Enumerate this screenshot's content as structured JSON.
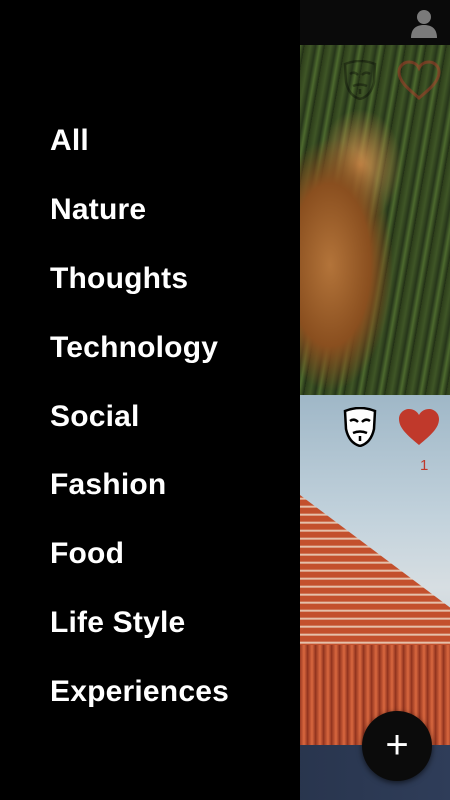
{
  "drawer": {
    "categories": [
      {
        "label": "All"
      },
      {
        "label": "Nature"
      },
      {
        "label": "Thoughts"
      },
      {
        "label": "Technology"
      },
      {
        "label": "Social"
      },
      {
        "label": "Fashion"
      },
      {
        "label": "Food"
      },
      {
        "label": "Life Style"
      },
      {
        "label": "Experiences"
      }
    ]
  },
  "header": {
    "profile_icon": "person-icon"
  },
  "feed": {
    "posts": [
      {
        "image": "fox-in-grass",
        "like_count": ""
      },
      {
        "image": "red-temple-roof",
        "like_count": "1"
      },
      {
        "image": "partial-post",
        "like_count": ""
      }
    ]
  },
  "fab": {
    "icon": "plus-icon"
  },
  "colors": {
    "drawer_background": "#000000",
    "drawer_text": "#ffffff",
    "heart": "#c0392b",
    "like_count": "#c0392b"
  }
}
